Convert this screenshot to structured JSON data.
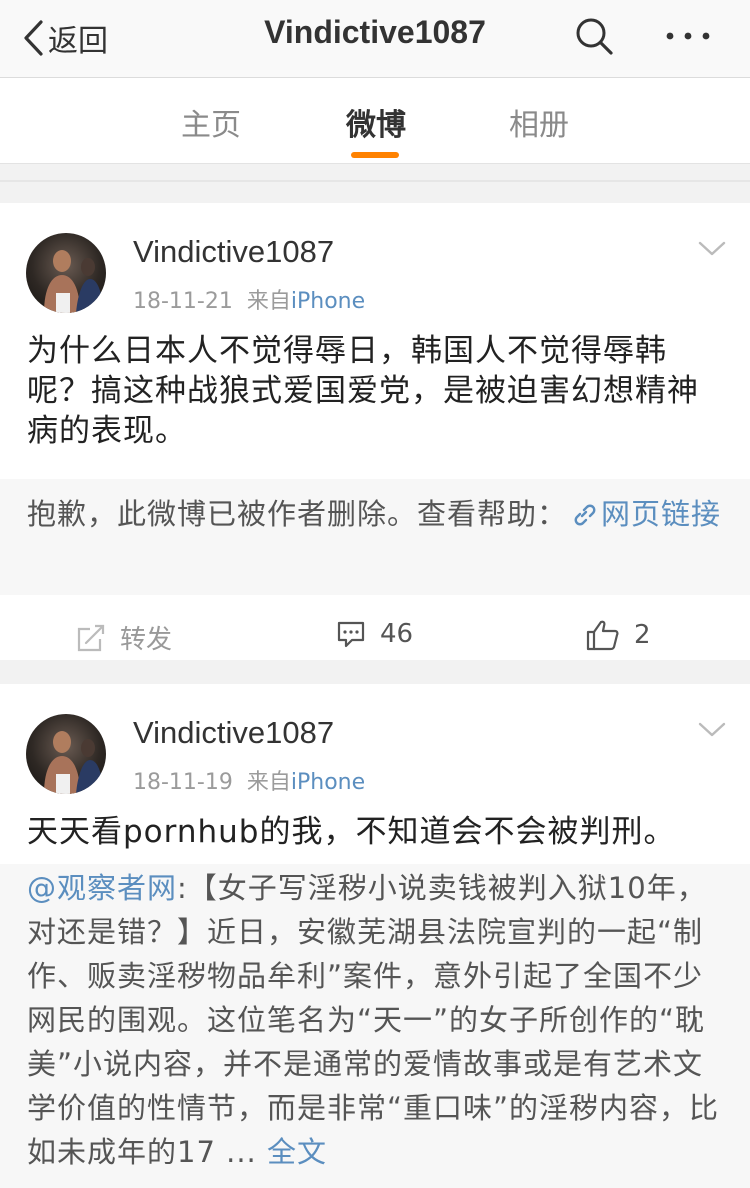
{
  "nav": {
    "back_label": "返回",
    "title": "Vindictive1087"
  },
  "tabs": [
    "主页",
    "微博",
    "相册"
  ],
  "active_tab": 1,
  "accent": "#ff8200",
  "posts": [
    {
      "username": "Vindictive1087",
      "date": "18-11-21",
      "source_prefix": "来自",
      "source": "iPhone",
      "text": "为什么日本人不觉得辱日，韩国人不觉得辱韩呢？搞这种战狼式爱国爱党，是被迫害幻想精神病的表现。",
      "repost_text": "抱歉，此微博已被作者删除。查看帮助：",
      "repost_link": "网页链接",
      "repost_link_icon": "link-icon",
      "repost_label": "转发",
      "comments": "46",
      "likes": "2"
    },
    {
      "username": "Vindictive1087",
      "date": "18-11-19",
      "source_prefix": "来自",
      "source": "iPhone",
      "text": "天天看pornhub的我，不知道会不会被判刑。",
      "repost_mention": "@观察者网",
      "repost_body": ":【女子写淫秽小说卖钱被判入狱10年，对还是错？】近日，安徽芜湖县法院宣判的一起“制作、贩卖淫秽物品牟利”案件，意外引起了全国不少网民的围观。这位笔名为“天一”的女子所创作的“耽美”小说内容，并不是通常的爱情故事或是有艺术文学价值的性情节，而是非常“重口味”的淫秽内容，比如未成年的17 ... ",
      "repost_more": "全文"
    }
  ]
}
